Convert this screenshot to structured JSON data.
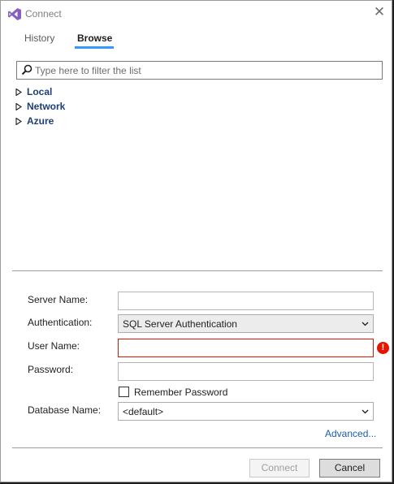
{
  "window": {
    "title": "Connect"
  },
  "tabs": [
    {
      "label": "History"
    },
    {
      "label": "Browse"
    }
  ],
  "filter": {
    "placeholder": "Type here to filter the list"
  },
  "tree": [
    {
      "label": "Local"
    },
    {
      "label": "Network"
    },
    {
      "label": "Azure"
    }
  ],
  "form": {
    "server_name_label": "Server Name:",
    "server_name_value": "",
    "authentication_label": "Authentication:",
    "authentication_value": "SQL Server Authentication",
    "user_name_label": "User Name:",
    "user_name_value": "",
    "password_label": "Password:",
    "password_value": "",
    "remember_password_label": "Remember Password",
    "remember_password_checked": false,
    "database_name_label": "Database Name:",
    "database_name_value": "<default>",
    "advanced_link": "Advanced...",
    "error_icon_glyph": "!"
  },
  "buttons": {
    "connect": "Connect",
    "cancel": "Cancel"
  },
  "colors": {
    "accent": "#3399ff",
    "error": "#e51400",
    "tree_text": "#1e3f73",
    "link": "#1e5ba8"
  },
  "icons": [
    "visual-studio-logo-icon",
    "close-icon",
    "search-icon",
    "expand-arrow-icon",
    "chevron-down-icon",
    "error-icon"
  ]
}
